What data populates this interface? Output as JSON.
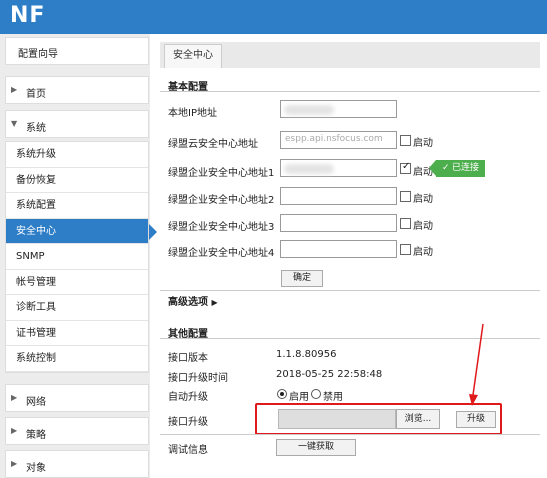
{
  "app": {
    "logo": "NF"
  },
  "sidebar": {
    "wizard": "配置向导",
    "groups_top": [
      {
        "label": "首页",
        "expanded": false
      },
      {
        "label": "系统",
        "expanded": true
      }
    ],
    "system_items": [
      "系统升级",
      "备份恢复",
      "系统配置",
      "安全中心",
      "SNMP",
      "帐号管理",
      "诊断工具",
      "证书管理",
      "系统控制"
    ],
    "active_item": "安全中心",
    "groups_bottom": [
      {
        "label": "网络"
      },
      {
        "label": "策略"
      },
      {
        "label": "对象"
      }
    ]
  },
  "tabs": [
    "安全中心"
  ],
  "basic": {
    "title": "基本配置",
    "local_ip_label": "本地IP地址",
    "cloud_label": "绿盟云安全中心地址",
    "cloud_placeholder": "espp.api.nsfocus.com",
    "enterprise_labels": [
      "绿盟企业安全中心地址1",
      "绿盟企业安全中心地址2",
      "绿盟企业安全中心地址3",
      "绿盟企业安全中心地址4"
    ],
    "enable_label": "启动",
    "connected_badge": "已连接",
    "confirm_button": "确定"
  },
  "advanced": {
    "title": "高级选项"
  },
  "other": {
    "title": "其他配置",
    "version_label": "接口版本",
    "version_value": "1.1.8.80956",
    "upgrade_time_label": "接口升级时间",
    "upgrade_time_value": "2018-05-25 22:58:48",
    "auto_upgrade_label": "自动升级",
    "enable_option": "启用",
    "disable_option": "禁用",
    "interface_upgrade_label": "接口升级",
    "browse_button": "浏览...",
    "upgrade_button": "升级",
    "debug_label": "调试信息",
    "fetch_button": "一键获取"
  },
  "colors": {
    "brand": "#2e7ec7",
    "success": "#4cae4c",
    "annotation": "#e0191b"
  }
}
